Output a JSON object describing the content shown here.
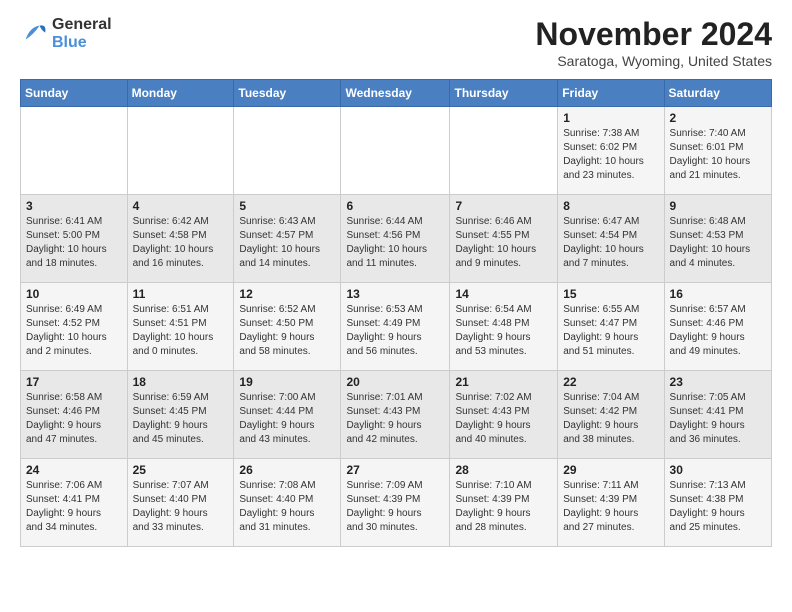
{
  "logo": {
    "general": "General",
    "blue": "Blue"
  },
  "title": "November 2024",
  "location": "Saratoga, Wyoming, United States",
  "weekdays": [
    "Sunday",
    "Monday",
    "Tuesday",
    "Wednesday",
    "Thursday",
    "Friday",
    "Saturday"
  ],
  "weeks": [
    [
      {
        "day": "",
        "info": ""
      },
      {
        "day": "",
        "info": ""
      },
      {
        "day": "",
        "info": ""
      },
      {
        "day": "",
        "info": ""
      },
      {
        "day": "",
        "info": ""
      },
      {
        "day": "1",
        "info": "Sunrise: 7:38 AM\nSunset: 6:02 PM\nDaylight: 10 hours\nand 23 minutes."
      },
      {
        "day": "2",
        "info": "Sunrise: 7:40 AM\nSunset: 6:01 PM\nDaylight: 10 hours\nand 21 minutes."
      }
    ],
    [
      {
        "day": "3",
        "info": "Sunrise: 6:41 AM\nSunset: 5:00 PM\nDaylight: 10 hours\nand 18 minutes."
      },
      {
        "day": "4",
        "info": "Sunrise: 6:42 AM\nSunset: 4:58 PM\nDaylight: 10 hours\nand 16 minutes."
      },
      {
        "day": "5",
        "info": "Sunrise: 6:43 AM\nSunset: 4:57 PM\nDaylight: 10 hours\nand 14 minutes."
      },
      {
        "day": "6",
        "info": "Sunrise: 6:44 AM\nSunset: 4:56 PM\nDaylight: 10 hours\nand 11 minutes."
      },
      {
        "day": "7",
        "info": "Sunrise: 6:46 AM\nSunset: 4:55 PM\nDaylight: 10 hours\nand 9 minutes."
      },
      {
        "day": "8",
        "info": "Sunrise: 6:47 AM\nSunset: 4:54 PM\nDaylight: 10 hours\nand 7 minutes."
      },
      {
        "day": "9",
        "info": "Sunrise: 6:48 AM\nSunset: 4:53 PM\nDaylight: 10 hours\nand 4 minutes."
      }
    ],
    [
      {
        "day": "10",
        "info": "Sunrise: 6:49 AM\nSunset: 4:52 PM\nDaylight: 10 hours\nand 2 minutes."
      },
      {
        "day": "11",
        "info": "Sunrise: 6:51 AM\nSunset: 4:51 PM\nDaylight: 10 hours\nand 0 minutes."
      },
      {
        "day": "12",
        "info": "Sunrise: 6:52 AM\nSunset: 4:50 PM\nDaylight: 9 hours\nand 58 minutes."
      },
      {
        "day": "13",
        "info": "Sunrise: 6:53 AM\nSunset: 4:49 PM\nDaylight: 9 hours\nand 56 minutes."
      },
      {
        "day": "14",
        "info": "Sunrise: 6:54 AM\nSunset: 4:48 PM\nDaylight: 9 hours\nand 53 minutes."
      },
      {
        "day": "15",
        "info": "Sunrise: 6:55 AM\nSunset: 4:47 PM\nDaylight: 9 hours\nand 51 minutes."
      },
      {
        "day": "16",
        "info": "Sunrise: 6:57 AM\nSunset: 4:46 PM\nDaylight: 9 hours\nand 49 minutes."
      }
    ],
    [
      {
        "day": "17",
        "info": "Sunrise: 6:58 AM\nSunset: 4:46 PM\nDaylight: 9 hours\nand 47 minutes."
      },
      {
        "day": "18",
        "info": "Sunrise: 6:59 AM\nSunset: 4:45 PM\nDaylight: 9 hours\nand 45 minutes."
      },
      {
        "day": "19",
        "info": "Sunrise: 7:00 AM\nSunset: 4:44 PM\nDaylight: 9 hours\nand 43 minutes."
      },
      {
        "day": "20",
        "info": "Sunrise: 7:01 AM\nSunset: 4:43 PM\nDaylight: 9 hours\nand 42 minutes."
      },
      {
        "day": "21",
        "info": "Sunrise: 7:02 AM\nSunset: 4:43 PM\nDaylight: 9 hours\nand 40 minutes."
      },
      {
        "day": "22",
        "info": "Sunrise: 7:04 AM\nSunset: 4:42 PM\nDaylight: 9 hours\nand 38 minutes."
      },
      {
        "day": "23",
        "info": "Sunrise: 7:05 AM\nSunset: 4:41 PM\nDaylight: 9 hours\nand 36 minutes."
      }
    ],
    [
      {
        "day": "24",
        "info": "Sunrise: 7:06 AM\nSunset: 4:41 PM\nDaylight: 9 hours\nand 34 minutes."
      },
      {
        "day": "25",
        "info": "Sunrise: 7:07 AM\nSunset: 4:40 PM\nDaylight: 9 hours\nand 33 minutes."
      },
      {
        "day": "26",
        "info": "Sunrise: 7:08 AM\nSunset: 4:40 PM\nDaylight: 9 hours\nand 31 minutes."
      },
      {
        "day": "27",
        "info": "Sunrise: 7:09 AM\nSunset: 4:39 PM\nDaylight: 9 hours\nand 30 minutes."
      },
      {
        "day": "28",
        "info": "Sunrise: 7:10 AM\nSunset: 4:39 PM\nDaylight: 9 hours\nand 28 minutes."
      },
      {
        "day": "29",
        "info": "Sunrise: 7:11 AM\nSunset: 4:39 PM\nDaylight: 9 hours\nand 27 minutes."
      },
      {
        "day": "30",
        "info": "Sunrise: 7:13 AM\nSunset: 4:38 PM\nDaylight: 9 hours\nand 25 minutes."
      }
    ]
  ]
}
